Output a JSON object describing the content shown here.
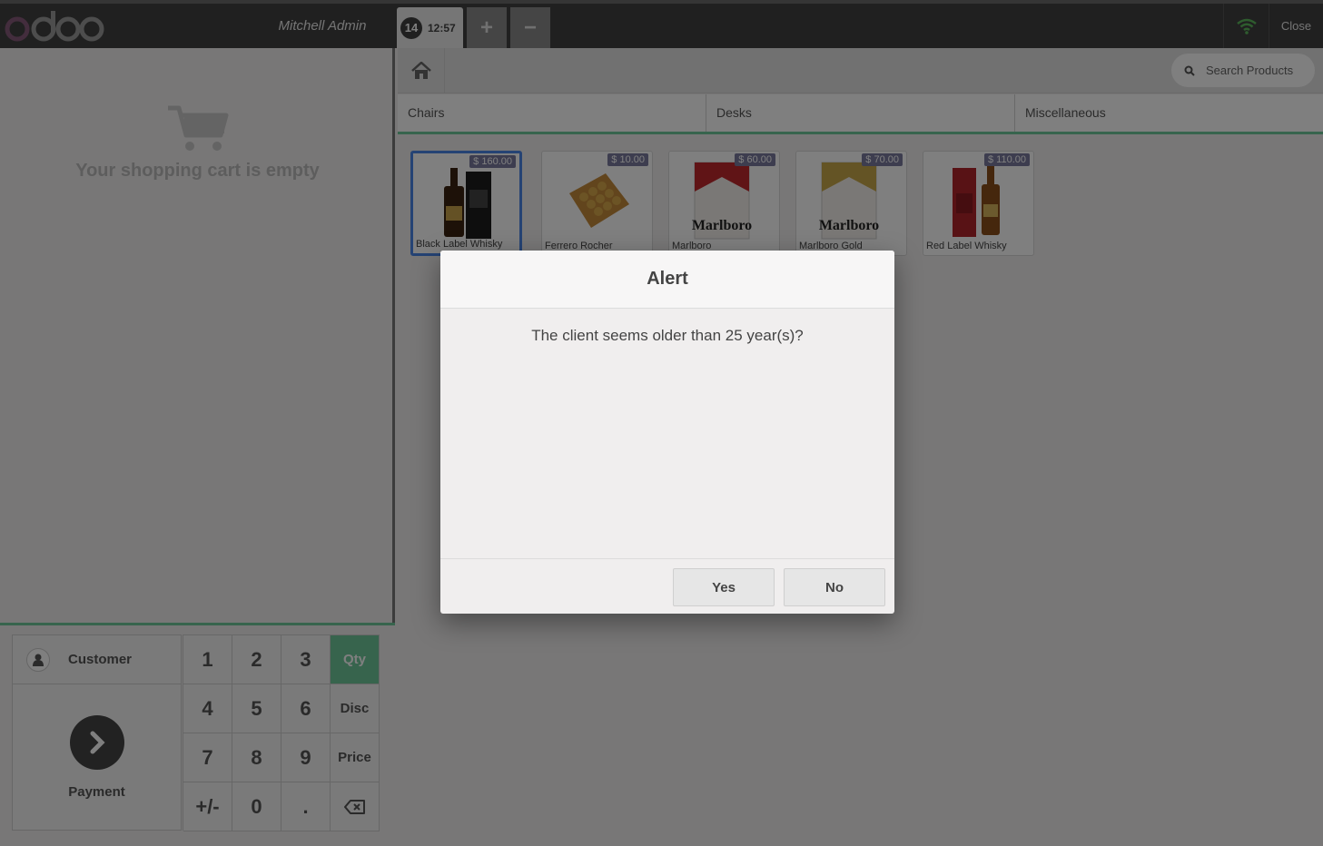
{
  "topbar": {
    "logo_text": "odoo",
    "cashier": "Mitchell Admin",
    "order": {
      "number": "14",
      "time": "12:57"
    },
    "add_order_label": "+",
    "remove_order_label": "−",
    "close_label": "Close"
  },
  "cart": {
    "empty_message": "Your shopping cart is empty"
  },
  "actionpad": {
    "customer_label": "Customer",
    "payment_label": "Payment"
  },
  "numpad": {
    "keys": [
      "1",
      "2",
      "3",
      "Qty",
      "4",
      "5",
      "6",
      "Disc",
      "7",
      "8",
      "9",
      "Price",
      "+/-",
      "0",
      ".",
      "⌫"
    ],
    "active_mode": "Qty"
  },
  "products_screen": {
    "search_placeholder": "Search Products",
    "categories": [
      "Chairs",
      "Desks",
      "Miscellaneous"
    ],
    "products": [
      {
        "name": "Black Label Whisky",
        "price": "$ 160.00",
        "selected": true
      },
      {
        "name": "Ferrero Rocher",
        "price": "$ 10.00"
      },
      {
        "name": "Marlboro",
        "price": "$ 60.00"
      },
      {
        "name": "Marlboro Gold",
        "price": "$ 70.00"
      },
      {
        "name": "Red Label Whisky",
        "price": "$ 110.00"
      }
    ]
  },
  "alert": {
    "title": "Alert",
    "message": "The client seems older than 25 year(s)?",
    "yes_label": "Yes",
    "no_label": "No"
  },
  "colors": {
    "accent": "#6ec89b",
    "topbar": "#414141",
    "selected_border": "#4a86e8",
    "logo_purple": "#875a7b"
  }
}
